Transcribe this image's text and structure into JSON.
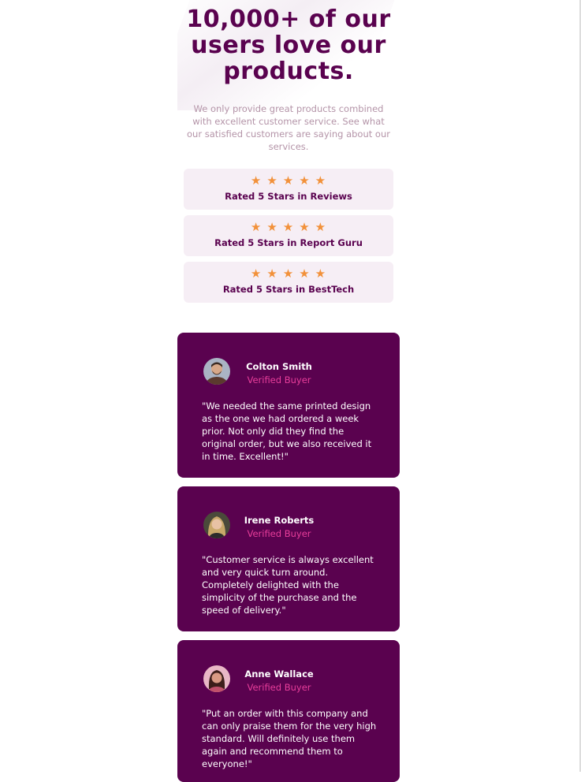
{
  "hero": {
    "title": "10,000+ of our users love our products.",
    "subtitle": "We only provide great products combined with excellent customer service. See what our satisfied customers are saying about our services."
  },
  "colors": {
    "brand": "#5a024f",
    "star": "#f2913a",
    "accent": "#e83e9b",
    "rating_bg": "#f6eef5"
  },
  "ratings": [
    {
      "stars": 5,
      "label": "Rated 5 Stars in Reviews"
    },
    {
      "stars": 5,
      "label": "Rated 5 Stars in Report Guru"
    },
    {
      "stars": 5,
      "label": "Rated 5 Stars in BestTech"
    }
  ],
  "testimonials": [
    {
      "name": "Colton Smith",
      "status": "Verified Buyer",
      "avatar_icon": "avatar-man-beard",
      "quote": "\"We needed the same printed design as the one we had ordered a week prior. Not only did they find the original order, but we also received it in time. Excellent!\""
    },
    {
      "name": "Irene Roberts",
      "status": "Verified Buyer",
      "avatar_icon": "avatar-woman-blonde",
      "quote": "\"Customer service is always excellent and very quick turn around. Completely delighted with the simplicity of the purchase and the speed of delivery.\""
    },
    {
      "name": "Anne Wallace",
      "status": "Verified Buyer",
      "avatar_icon": "avatar-woman-dark",
      "quote": "\"Put an order with this company and can only praise them for the very high standard. Will definitely use them again and recommend them to everyone!\""
    }
  ]
}
